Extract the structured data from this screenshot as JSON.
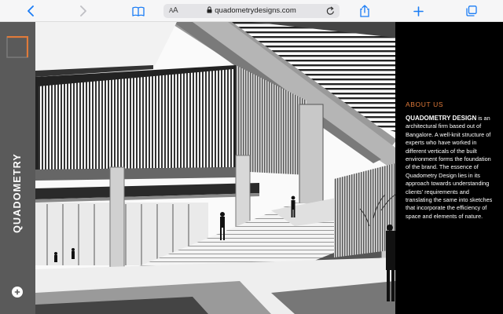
{
  "browser": {
    "url": "quadometrydesigns.com",
    "text_size_label_small": "A",
    "text_size_label_large": "A"
  },
  "sidebar": {
    "brand_vertical": "QUADOMETRY",
    "logo_color": "#e07a3a"
  },
  "about": {
    "title": "ABOUT US",
    "company_name": "QUADOMETRY DESIGN",
    "body": " is an architectural firm based out of Bangalore. A well-knit structure of experts who have worked in different verticals of the built environment forms the foundation of the brand. The essence of Quadometry Design lies in its approach towards understanding clients' requirements and translating the same into sketches that incorporate the efficiency of space and elements of nature."
  },
  "colors": {
    "accent": "#e07a3a",
    "browser_blue": "#1a7cf5",
    "sidebar_bg": "#5a5a5a",
    "panel_bg": "#000000"
  }
}
